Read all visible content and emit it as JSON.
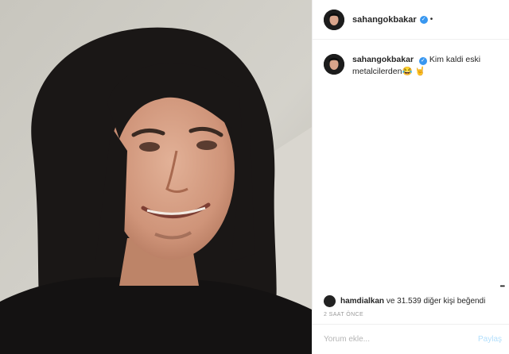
{
  "post": {
    "photo_alt": "smiling man wearing long black wig",
    "author": {
      "username": "sahangokbakar",
      "verified_icon": "verified-badge-icon",
      "header_dot": "•"
    },
    "caption": {
      "username": "sahangokbakar",
      "text": "Kim kaldi eski metalcilerden",
      "emojis": "😂 🤘"
    },
    "more_options": "•••",
    "likes": {
      "user": "hamdialkan",
      "rest": "ve 31.539 diğer kişi beğendi"
    },
    "timestamp": "2 SAAT ÖNCE",
    "comment": {
      "placeholder": "Yorum ekle...",
      "post_label": "Paylaş"
    }
  },
  "colors": {
    "verified": "#3897f0",
    "text": "#262626",
    "muted": "#999999",
    "post_disabled": "#b2dffc"
  }
}
